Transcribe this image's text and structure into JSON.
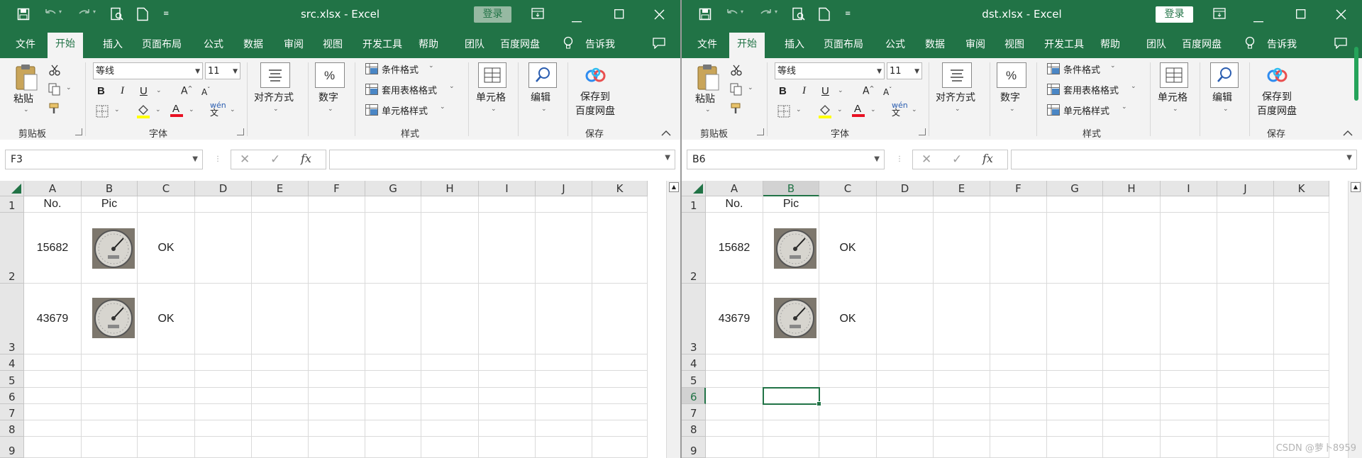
{
  "windows": [
    {
      "title": "src.xlsx  -  Excel",
      "login": "登录",
      "tabs": [
        "文件",
        "开始",
        "插入",
        "页面布局",
        "公式",
        "数据",
        "审阅",
        "视图",
        "开发工具",
        "帮助",
        "团队",
        "百度网盘"
      ],
      "tell_me": "告诉我",
      "ribbon": {
        "paste": "粘贴",
        "clipboard": "剪贴板",
        "font_name": "等线",
        "font_size": "11",
        "font_group": "字体",
        "align": "对齐方式",
        "number": "数字",
        "cond_format": "条件格式",
        "table_format": "套用表格格式",
        "cell_style": "单元格样式",
        "style_group": "样式",
        "cells": "单元格",
        "edit": "编辑",
        "save_to_pan_1": "保存到",
        "save_to_pan_2": "百度网盘",
        "save_group": "保存"
      },
      "name_box": "F3",
      "columns": [
        "A",
        "B",
        "C",
        "D",
        "E",
        "F",
        "G",
        "H",
        "I",
        "J",
        "K"
      ],
      "rows": [
        "1",
        "2",
        "3",
        "4",
        "5",
        "6",
        "7",
        "8",
        "9"
      ],
      "cells": {
        "A1": "No.",
        "B1": "Pic",
        "A2": "15682",
        "C2": "OK",
        "A3": "43679",
        "C3": "OK"
      },
      "images": [
        "pressure-gauge-photo",
        "pressure-gauge-photo"
      ]
    },
    {
      "title": "dst.xlsx  -  Excel",
      "login": "登录",
      "tabs": [
        "文件",
        "开始",
        "插入",
        "页面布局",
        "公式",
        "数据",
        "审阅",
        "视图",
        "开发工具",
        "帮助",
        "团队",
        "百度网盘"
      ],
      "tell_me": "告诉我",
      "ribbon": {
        "paste": "粘贴",
        "clipboard": "剪贴板",
        "font_name": "等线",
        "font_size": "11",
        "font_group": "字体",
        "align": "对齐方式",
        "number": "数字",
        "cond_format": "条件格式",
        "table_format": "套用表格格式",
        "cell_style": "单元格样式",
        "style_group": "样式",
        "cells": "单元格",
        "edit": "编辑",
        "save_to_pan_1": "保存到",
        "save_to_pan_2": "百度网盘",
        "save_group": "保存"
      },
      "name_box": "B6",
      "columns": [
        "A",
        "B",
        "C",
        "D",
        "E",
        "F",
        "G",
        "H",
        "I",
        "J",
        "K"
      ],
      "rows": [
        "1",
        "2",
        "3",
        "4",
        "5",
        "6",
        "7",
        "8",
        "9"
      ],
      "cells": {
        "A1": "No.",
        "B1": "Pic",
        "A2": "15682",
        "C2": "OK",
        "A3": "43679",
        "C3": "OK"
      },
      "images": [
        "pressure-gauge-photo",
        "pressure-gauge-photo"
      ]
    }
  ],
  "watermark": "CSDN @萝卜8959",
  "colors": {
    "excel_green": "#217346",
    "ribbon_bg": "#f3f3f3",
    "font_red": "#e81123",
    "highlight_yellow": "#ffff00"
  }
}
